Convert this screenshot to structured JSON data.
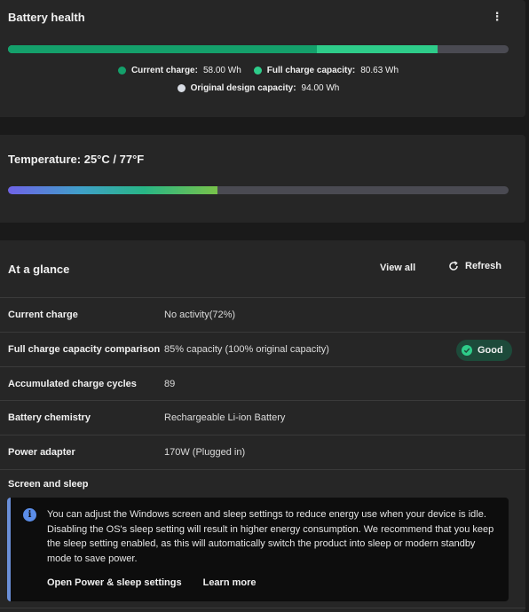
{
  "battery_health": {
    "title": "Battery health",
    "more_icon": "more-vertical-icon",
    "more_glyph": "⋮",
    "current_charge_fraction": 0.617,
    "full_charge_fraction": 0.858,
    "colors": {
      "current": "#14a06b",
      "full": "#2ecc8a",
      "design": "#d8dce4",
      "track": "#4a4a52"
    },
    "legend": {
      "current_label": "Current charge:",
      "current_value": "58.00 Wh",
      "full_label": "Full charge capacity:",
      "full_value": "80.63 Wh",
      "design_label": "Original design capacity:",
      "design_value": "94.00 Wh"
    }
  },
  "temperature": {
    "title": "Temperature:  25°C / 77°F",
    "level_fraction": 0.418
  },
  "at_a_glance": {
    "title": "At a glance",
    "view_all": "View all",
    "refresh": "Refresh",
    "refresh_icon": "refresh-icon",
    "rows": [
      {
        "label": "Current charge",
        "value": "No activity(72%)"
      },
      {
        "label": "Full charge capacity comparison",
        "value": "85% capacity (100% original capacity)",
        "badge": "Good"
      },
      {
        "label": "Accumulated charge cycles",
        "value": "89"
      },
      {
        "label": "Battery chemistry",
        "value": "Rechargeable Li-ion Battery"
      },
      {
        "label": "Power adapter",
        "value": "170W (Plugged in)"
      }
    ],
    "screen_sleep": {
      "label": "Screen and sleep",
      "info_icon": "info-icon",
      "info_glyph": "i",
      "message": "You can adjust the Windows screen and sleep settings to reduce energy use when your device is idle. Disabling the OS's sleep setting will result in higher energy consumption. We recommend that you keep the sleep setting enabled, as this will automatically switch the product into sleep or modern standby mode to save power.",
      "link_power": "Open Power & sleep settings",
      "link_learn": "Learn more"
    }
  }
}
